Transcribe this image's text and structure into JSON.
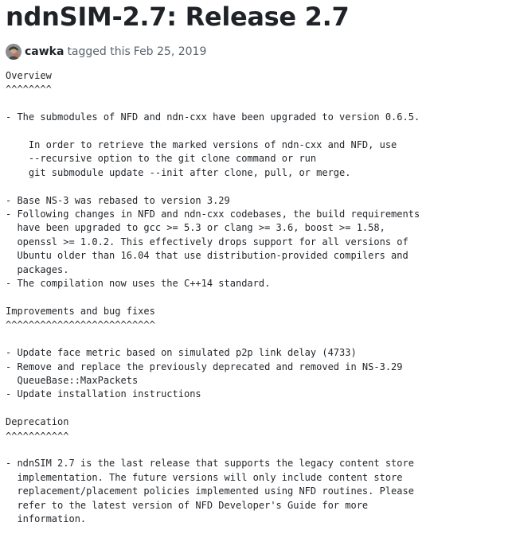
{
  "release": {
    "title": "ndnSIM-2.7: Release 2.7",
    "author": "cawka",
    "action": "tagged this",
    "date": "Feb 25, 2019",
    "notes": "Overview\n^^^^^^^^\n\n- The submodules of NFD and ndn-cxx have been upgraded to version 0.6.5.\n\n    In order to retrieve the marked versions of ndn-cxx and NFD, use\n    --recursive option to the git clone command or run\n    git submodule update --init after clone, pull, or merge.\n\n- Base NS-3 was rebased to version 3.29\n- Following changes in NFD and ndn-cxx codebases, the build requirements\n  have been upgraded to gcc >= 5.3 or clang >= 3.6, boost >= 1.58,\n  openssl >= 1.0.2. This effectively drops support for all versions of\n  Ubuntu older than 16.04 that use distribution-provided compilers and\n  packages.\n- The compilation now uses the C++14 standard.\n\nImprovements and bug fixes\n^^^^^^^^^^^^^^^^^^^^^^^^^^\n\n- Update face metric based on simulated p2p link delay (4733)\n- Remove and replace the previously deprecated and removed in NS-3.29\n  QueueBase::MaxPackets\n- Update installation instructions\n\nDeprecation\n^^^^^^^^^^^\n\n- ndnSIM 2.7 is the last release that supports the legacy content store\n  implementation. The future versions will only include content store\n  replacement/placement policies implemented using NFD routines. Please\n  refer to the latest version of NFD Developer's Guide for more\n  information."
  },
  "icons": {
    "avatar": "user-avatar"
  },
  "colors": {
    "text": "#1f2328",
    "muted": "#59636e",
    "background": "#ffffff"
  }
}
